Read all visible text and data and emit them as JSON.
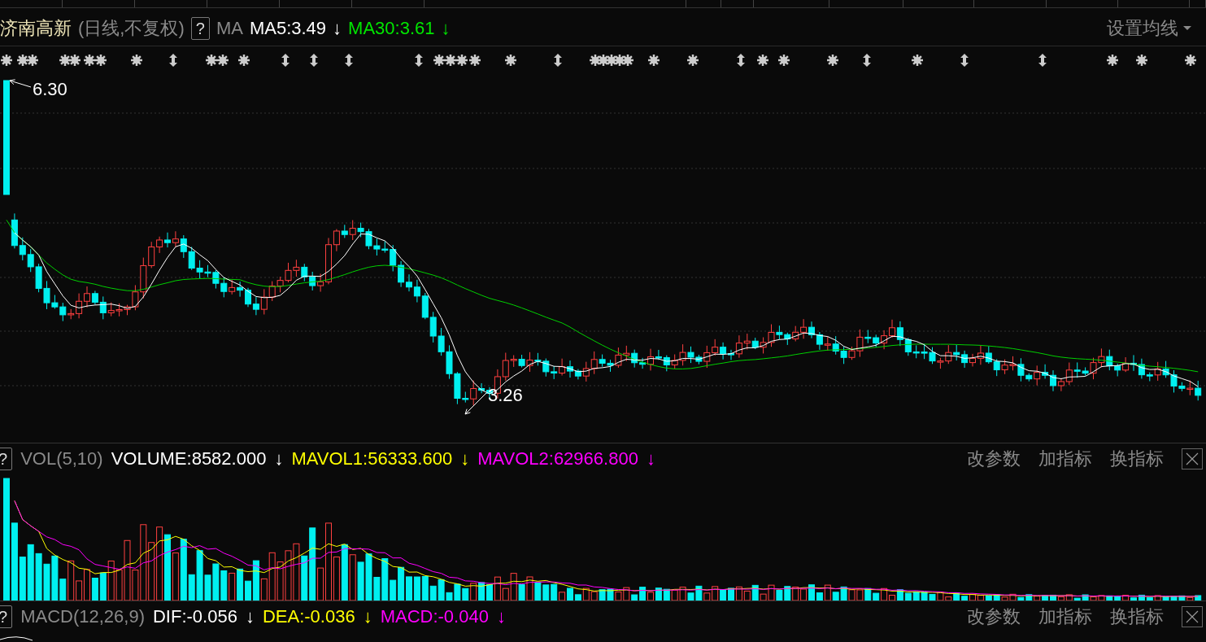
{
  "header": {
    "stock_name": "济南高新",
    "period": "(日线,不复权)",
    "help": "?",
    "indicator": "MA",
    "values": [
      {
        "text": "MA5:3.49",
        "arrow": "↓",
        "color": "#ffffff"
      },
      {
        "text": "MA30:3.61",
        "arrow": "↓",
        "color": "#00e600"
      }
    ],
    "setting": "设置均线"
  },
  "price_chart": {
    "high_label": "6.30",
    "low_label": "3.26"
  },
  "panels": [
    {
      "help": "?",
      "name": "VOL(5,10)",
      "values": [
        {
          "text": "VOLUME:8582.000",
          "arrow": "↓",
          "color": "#ffffff"
        },
        {
          "text": "MAVOL1:56333.600",
          "arrow": "↓",
          "color": "#ffff00"
        },
        {
          "text": "MAVOL2:62966.800",
          "arrow": "↓",
          "color": "#ff00ff"
        }
      ],
      "actions": [
        "改参数",
        "加指标",
        "换指标"
      ],
      "kind": "volume"
    },
    {
      "help": "?",
      "name": "MACD(12,26,9)",
      "values": [
        {
          "text": "DIF:-0.056",
          "arrow": "↓",
          "color": "#ffffff"
        },
        {
          "text": "DEA:-0.036",
          "arrow": "↓",
          "color": "#ffff00"
        },
        {
          "text": "MACD:-0.040",
          "arrow": "↓",
          "color": "#ff00ff"
        }
      ],
      "actions": [
        "改参数",
        "加指标",
        "换指标"
      ],
      "kind": "macd"
    }
  ]
}
